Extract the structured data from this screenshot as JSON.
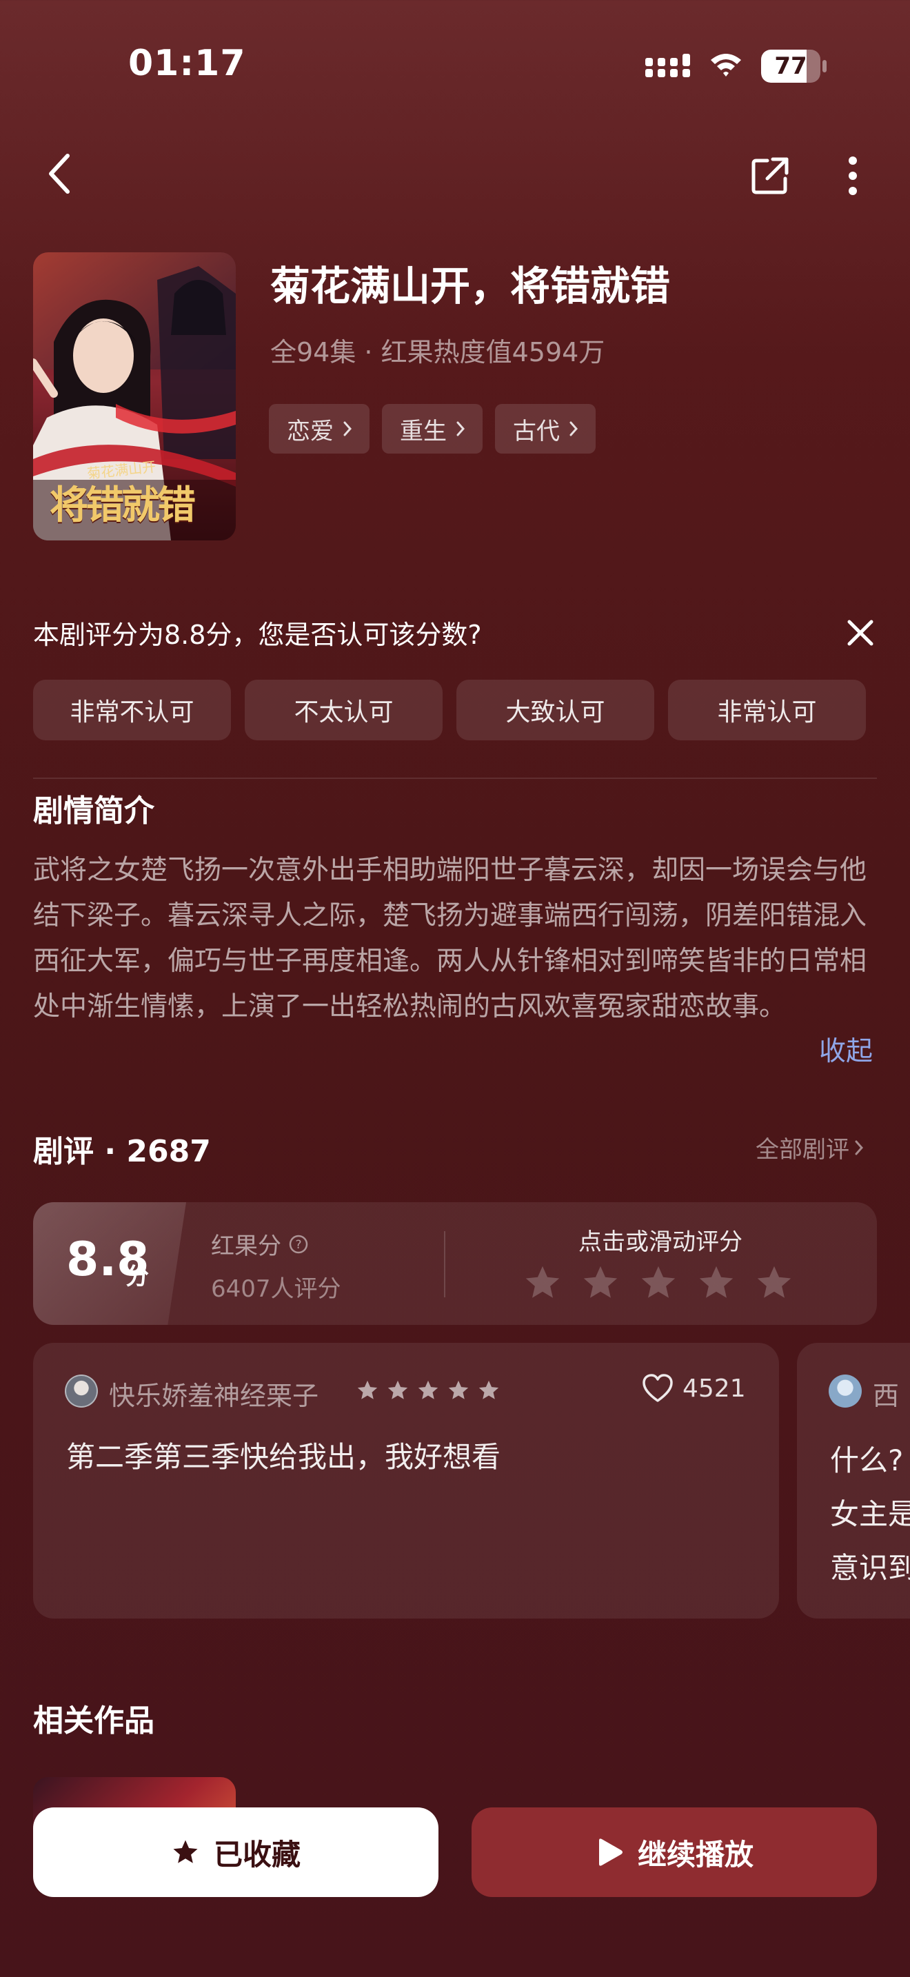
{
  "status_bar": {
    "time": "01:17",
    "battery": "77",
    "battery_level": 0.77
  },
  "show": {
    "title": "菊花满山开，将错就错",
    "meta": "全94集 · 红果热度值4594万",
    "tags": [
      "恋爱",
      "重生",
      "古代"
    ],
    "poster_text": "将错就错",
    "poster_subtext": "菊花满山开"
  },
  "rating_prompt": {
    "question": "本剧评分为8.8分，您是否认可该分数?",
    "options": [
      "非常不认可",
      "不太认可",
      "大致认可",
      "非常认可"
    ]
  },
  "synopsis": {
    "heading": "剧情简介",
    "text": "武将之女楚飞扬一次意外出手相助端阳世子暮云深，却因一场误会与他结下梁子。暮云深寻人之际，楚飞扬为避事端西行闯荡，阴差阳错混入西征大军，偏巧与世子再度相逢。两人从针锋相对到啼笑皆非的日常相处中渐生情愫，上演了一出轻松热闹的古风欢喜冤家甜恋故事。",
    "collapse_label": "收起"
  },
  "reviews": {
    "heading": "剧评 · 2687",
    "all_label": "全部剧评",
    "score": "8.8",
    "score_unit": "分",
    "score_label": "红果分",
    "rater_count": "6407人评分",
    "rate_hint": "点击或滑动评分",
    "items": [
      {
        "user": "快乐娇羞神经栗子",
        "stars": 5,
        "likes": "4521",
        "text": "第二季第三季快给我出，我好想看"
      },
      {
        "user": "西",
        "lines": [
          "什么?",
          "女主是",
          "意识到"
        ]
      }
    ]
  },
  "related": {
    "heading": "相关作品"
  },
  "actions": {
    "favorite_label": "已收藏",
    "play_label": "继续播放"
  },
  "colors": {
    "link": "#8fa6e8",
    "play_button": "#8f2c30",
    "background": "#4c1618"
  }
}
